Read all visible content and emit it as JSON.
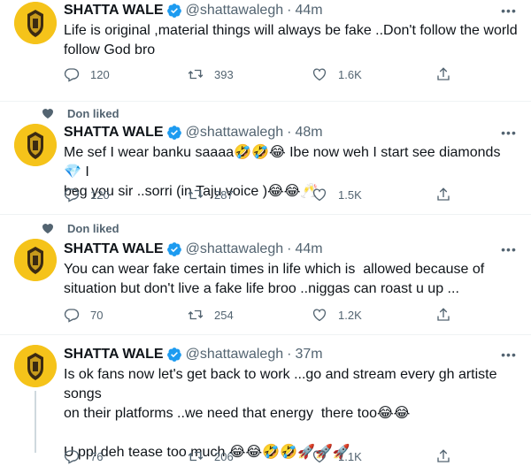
{
  "tweets": [
    {
      "name": "SHATTA WALE",
      "handle": "@shattawalegh",
      "time": "44m",
      "text": "Life is original ,material things will always be fake ..Don't follow the world\nfollow God bro",
      "replies": "120",
      "retweets": "393",
      "likes": "1.6K"
    },
    {
      "liked_by": "Don liked",
      "name": "SHATTA WALE",
      "handle": "@shattawalegh",
      "time": "48m",
      "text": "Me sef I wear banku saaaa🤣🤣😂 Ibe now weh I start see diamonds 💎 I\nbeg you sir ..sorri (in Taju voice )😂😂🥂",
      "replies": "120",
      "retweets": "287",
      "likes": "1.5K"
    },
    {
      "liked_by": "Don liked",
      "name": "SHATTA WALE",
      "handle": "@shattawalegh",
      "time": "44m",
      "text": "You can wear fake certain times in life which is  allowed because of\nsituation but don't live a fake life broo ..niggas can roast u up ...",
      "replies": "70",
      "retweets": "254",
      "likes": "1.2K"
    },
    {
      "name": "SHATTA WALE",
      "handle": "@shattawalegh",
      "time": "37m",
      "text": "Is ok fans now let's get back to work ...go and stream every gh artiste songs\non their platforms ..we need that energy  there too😂😂\n\nU ppl deh tease too much 😂😂🤣🤣🚀🚀🚀",
      "replies": "76",
      "retweets": "206",
      "likes": "1.1K"
    }
  ],
  "icons": {
    "verified": "verified-badge-icon",
    "reply": "reply-icon",
    "retweet": "retweet-icon",
    "like": "like-icon",
    "share": "share-icon",
    "more": "more-icon",
    "liked_heart": "heart-icon"
  },
  "colors": {
    "verified": "#1d9bf0",
    "secondary_text": "#536471",
    "avatar_bg": "#f5c31a",
    "divider": "#eff3f4"
  }
}
